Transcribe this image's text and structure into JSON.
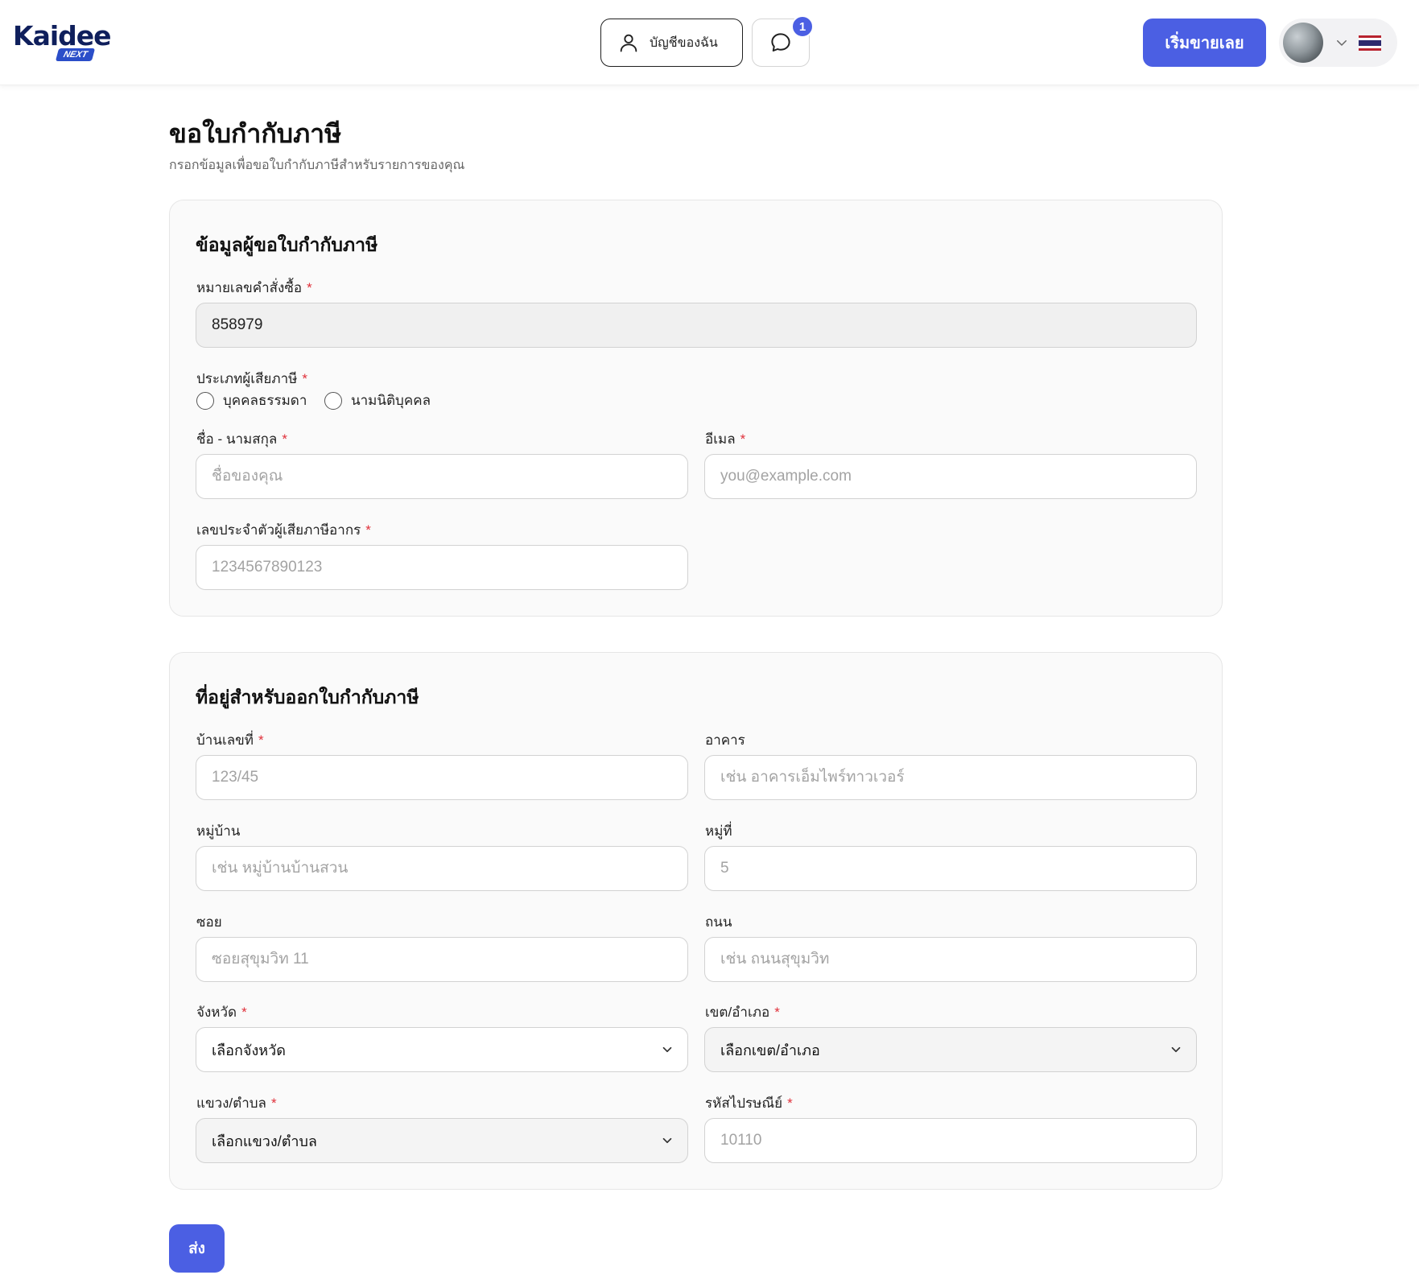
{
  "header": {
    "logo_text": "Kaidee",
    "logo_badge": "NEXT",
    "account_label": "บัญชีของฉัน",
    "chat_badge": "1",
    "sell_label": "เริ่มขายเลย",
    "icons": [
      "user-icon",
      "chat-bubble-icon",
      "chevron-down-icon",
      "thai-flag-icon"
    ]
  },
  "page": {
    "title": "ขอใบกำกับภาษี",
    "subtitle": "กรอกข้อมูลเพื่อขอใบกำกับภาษีสำหรับรายการของคุณ"
  },
  "requester": {
    "section_title": "ข้อมูลผู้ขอใบกำกับภาษี",
    "order_label": "หมายเลขคำสั่งซื้อ",
    "order_value": "858979",
    "taxpayer_type_label": "ประเภทผู้เสียภาษี",
    "taxpayer_options": [
      "บุคคลธรรมดา",
      "นามนิติบุคคล"
    ],
    "name_label": "ชื่อ - นามสกุล",
    "name_placeholder": "ชื่อของคุณ",
    "email_label": "อีเมล",
    "email_placeholder": "you@example.com",
    "taxid_label": "เลขประจำตัวผู้เสียภาษีอากร",
    "taxid_placeholder": "1234567890123"
  },
  "address": {
    "section_title": "ที่อยู่สำหรับออกใบกำกับภาษี",
    "house_label": "บ้านเลขที่",
    "house_placeholder": "123/45",
    "building_label": "อาคาร",
    "building_placeholder": "เช่น อาคารเอ็มไพร์ทาวเวอร์",
    "village_label": "หมู่บ้าน",
    "village_placeholder": "เช่น หมู่บ้านบ้านสวน",
    "moo_label": "หมู่ที่",
    "moo_placeholder": "5",
    "soi_label": "ซอย",
    "soi_placeholder": "ซอยสุขุมวิท 11",
    "road_label": "ถนน",
    "road_placeholder": "เช่น ถนนสุขุมวิท",
    "province_label": "จังหวัด",
    "province_value": "เลือกจังหวัด",
    "district_label": "เขต/อำเภอ",
    "district_value": "เลือกเขต/อำเภอ",
    "subdistrict_label": "แขวง/ตำบล",
    "subdistrict_value": "เลือกแขวง/ตำบล",
    "postal_label": "รหัสไปรษณีย์",
    "postal_placeholder": "10110"
  },
  "actions": {
    "required_mark": "*",
    "submit_label": "ส่ง"
  },
  "colors": {
    "accent": "#4b5fe3",
    "required": "#e0303a",
    "logo": "#0f1f5c"
  }
}
